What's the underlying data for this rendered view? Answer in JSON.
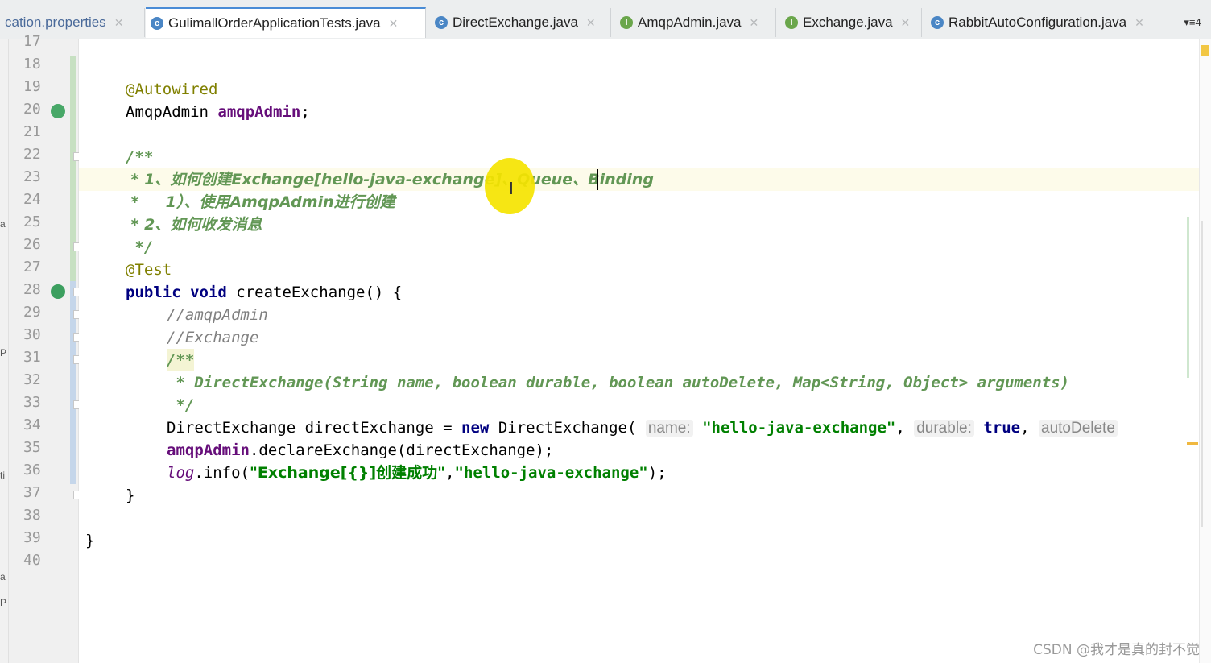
{
  "tabs": [
    {
      "label": "cation.properties",
      "icon": "properties-file-icon",
      "active": false
    },
    {
      "label": "GulimallOrderApplicationTests.java",
      "icon": "class-icon",
      "active": true
    },
    {
      "label": "DirectExchange.java",
      "icon": "class-icon",
      "active": false
    },
    {
      "label": "AmqpAdmin.java",
      "icon": "interface-icon",
      "active": false
    },
    {
      "label": "Exchange.java",
      "icon": "interface-icon",
      "active": false
    },
    {
      "label": "RabbitAutoConfiguration.java",
      "icon": "class-icon",
      "active": false
    }
  ],
  "tab_overflow_label": "▾≡4",
  "line_numbers": [
    "17",
    "18",
    "19",
    "20",
    "21",
    "22",
    "23",
    "24",
    "25",
    "26",
    "27",
    "28",
    "29",
    "30",
    "31",
    "32",
    "33",
    "34",
    "35",
    "36",
    "37",
    "38",
    "39",
    "40"
  ],
  "code": {
    "l19_annotation": "@Autowired",
    "l20_type": "AmqpAdmin ",
    "l20_field": "amqpAdmin",
    "l20_end": ";",
    "l22": "/**",
    "l23": " * 1、如何创建Exchange[hello-java-exchange]、Queue、Binding",
    "l24": " *     1）、使用AmqpAdmin进行创建",
    "l25": " * 2、如何收发消息",
    "l26": " */",
    "l27": "@Test",
    "l28_kw1": "public",
    "l28_kw2": "void",
    "l28_rest": " createExchange() {",
    "l29": "//amqpAdmin",
    "l30": "//Exchange",
    "l31": "/**",
    "l32": " * DirectExchange(String name, boolean durable, boolean autoDelete, Map<String, Object> arguments)",
    "l33": " */",
    "l34_a": "DirectExchange directExchange = ",
    "l34_new": "new",
    "l34_b": " DirectExchange( ",
    "l34_hint1": "name:",
    "l34_str": "\"hello-java-exchange\"",
    "l34_c": ", ",
    "l34_hint2": "durable:",
    "l34_true": "true",
    "l34_d": ", ",
    "l34_hint3": "autoDelete",
    "l35_field": "amqpAdmin",
    "l35_rest": ".declareExchange(directExchange);",
    "l36_log": "log",
    "l36_a": ".info(",
    "l36_str1": "\"Exchange[{}]创建成功\"",
    "l36_b": ",",
    "l36_str2": "\"hello-java-exchange\"",
    "l36_c": ");",
    "l37": "}",
    "l39": "}"
  },
  "left_strip_letters": [
    "a",
    "P",
    "ti",
    "a",
    "P"
  ],
  "watermark": "CSDN @我才是真的封不觉",
  "colors": {
    "annotation": "#808000",
    "keyword": "#000080",
    "field": "#660e7a",
    "doc_comment": "#629755",
    "comment": "#808080",
    "string": "#008000",
    "cursor_highlight": "#f5e400"
  }
}
